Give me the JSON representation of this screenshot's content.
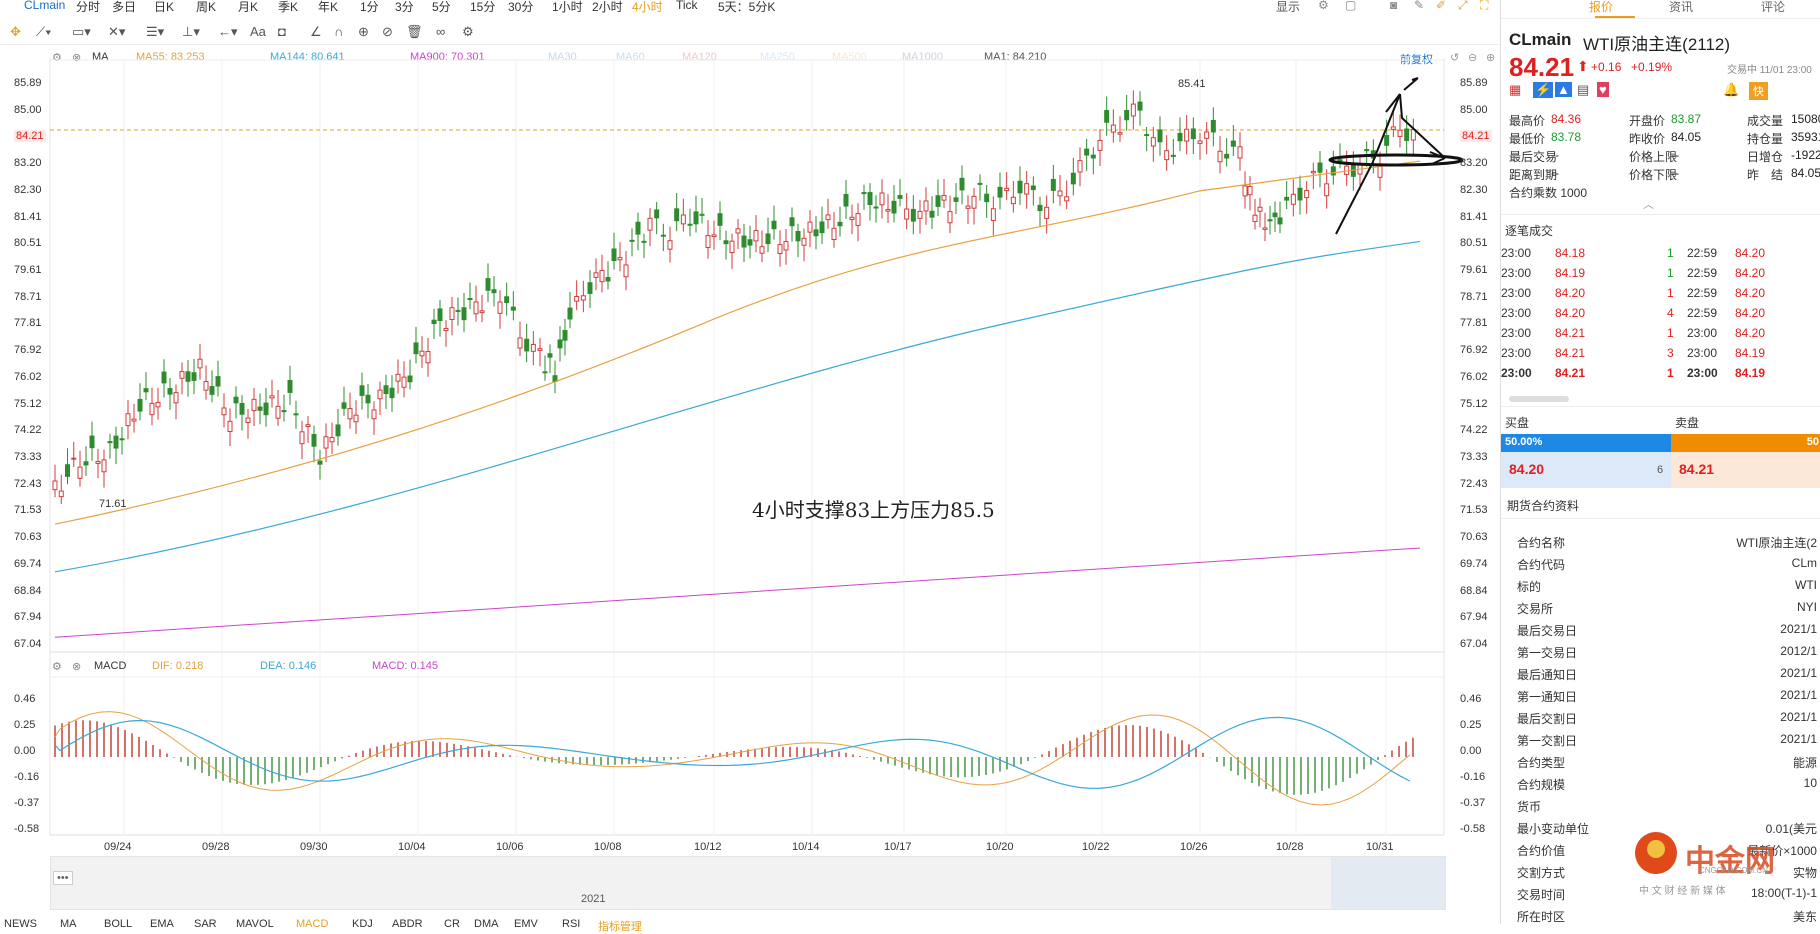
{
  "topbar": {
    "symbol": "CLmain",
    "periods": [
      "分时",
      "多日",
      "日K",
      "周K",
      "月K",
      "季K",
      "年K",
      "1分",
      "3分",
      "5分",
      "15分",
      "30分",
      "1小时",
      "2小时",
      "4小时",
      "Tick",
      "5天：5分K"
    ],
    "active_period": "4小时",
    "display_label": "显示"
  },
  "toolbar": {
    "restore_label": "前复权"
  },
  "ma_legend": {
    "title": "MA",
    "items": [
      {
        "label": "MA55: 83.253",
        "color": "#e8a040"
      },
      {
        "label": "MA144: 80.641",
        "color": "#3aa8d8"
      },
      {
        "label": "MA900: 70.301",
        "color": "#cc44cc"
      },
      {
        "label": "MA30",
        "color": "#c8d8e8"
      },
      {
        "label": "MA60",
        "color": "#c8e0f0"
      },
      {
        "label": "MA120",
        "color": "#f0c8c8"
      },
      {
        "label": "MA250",
        "color": "#d8e8f8"
      },
      {
        "label": "MA500",
        "color": "#f8e8c8"
      },
      {
        "label": "MA1000",
        "color": "#d0d0e0"
      },
      {
        "label": "MA1: 84.210",
        "color": "#555555"
      }
    ]
  },
  "price_axis": [
    "85.89",
    "85.00",
    "84.21",
    "83.20",
    "82.30",
    "81.41",
    "80.51",
    "79.61",
    "78.71",
    "77.81",
    "76.92",
    "76.02",
    "75.12",
    "74.22",
    "73.33",
    "72.43",
    "71.53",
    "70.63",
    "69.74",
    "68.84",
    "67.94",
    "67.04"
  ],
  "annotations": {
    "high_label": "85.41",
    "low_label": "71.61",
    "main_text": "4小时支撑83上方压力85.5"
  },
  "macd_legend": {
    "title": "MACD",
    "dif": "DIF: 0.218",
    "dea": "DEA: 0.146",
    "macd": "MACD: 0.145"
  },
  "macd_axis": [
    "0.46",
    "0.25",
    "0.00",
    "-0.16",
    "-0.37",
    "-0.58"
  ],
  "date_axis": [
    "09/24",
    "09/28",
    "09/30",
    "10/04",
    "10/06",
    "10/08",
    "10/12",
    "10/14",
    "10/17",
    "10/20",
    "10/22",
    "10/26",
    "10/28",
    "10/31"
  ],
  "navigator_year": "2021",
  "bottom_tabs": [
    "NEWS",
    "MA",
    "BOLL",
    "EMA",
    "SAR",
    "MAVOL",
    "MACD",
    "KDJ",
    "ABDR",
    "CR",
    "DMA",
    "EMV",
    "RSI",
    "指标管理"
  ],
  "quote": {
    "tabs": [
      "报价",
      "资讯",
      "评论"
    ],
    "code": "CLmain",
    "name": "WTI原油主连(2112)",
    "price": "84.21",
    "change": "+0.16",
    "change_pct": "+0.19%",
    "trade_time": "交易中 11/01 23:00",
    "fields": [
      {
        "k": "最高价",
        "v": "84.36",
        "c": "red"
      },
      {
        "k": "开盘价",
        "v": "83.87",
        "c": "green"
      },
      {
        "k": "成交量",
        "v": "15080",
        "c": "black"
      },
      {
        "k": "最低价",
        "v": "83.78",
        "c": "green"
      },
      {
        "k": "昨收价",
        "v": "84.05",
        "c": "black"
      },
      {
        "k": "持仓量",
        "v": "35931",
        "c": "black"
      },
      {
        "k": "最后交易",
        "v": "--",
        "c": "black"
      },
      {
        "k": "价格上限",
        "v": "--",
        "c": "black"
      },
      {
        "k": "日增仓",
        "v": "-1922",
        "c": "black"
      },
      {
        "k": "距离到期",
        "v": "--",
        "c": "black"
      },
      {
        "k": "价格下限",
        "v": "--",
        "c": "black"
      },
      {
        "k": "昨　结",
        "v": "84.05",
        "c": "black"
      }
    ],
    "multiplier": "合约乘数 1000"
  },
  "trades": {
    "title": "逐笔成交",
    "rows": [
      {
        "t1": "23:00",
        "p1": "84.18",
        "q": "1",
        "t2": "22:59",
        "p2": "84.20"
      },
      {
        "t1": "23:00",
        "p1": "84.19",
        "q": "1",
        "t2": "22:59",
        "p2": "84.20"
      },
      {
        "t1": "23:00",
        "p1": "84.20",
        "q": "1",
        "t2": "22:59",
        "p2": "84.20"
      },
      {
        "t1": "23:00",
        "p1": "84.20",
        "q": "4",
        "t2": "22:59",
        "p2": "84.20"
      },
      {
        "t1": "23:00",
        "p1": "84.21",
        "q": "1",
        "t2": "23:00",
        "p2": "84.20"
      },
      {
        "t1": "23:00",
        "p1": "84.21",
        "q": "3",
        "t2": "23:00",
        "p2": "84.19"
      },
      {
        "t1": "23:00",
        "p1": "84.21",
        "q": "1",
        "t2": "23:00",
        "p2": "84.19"
      }
    ]
  },
  "book": {
    "buy_label": "买盘",
    "sell_label": "卖盘",
    "buy_pct": "50.00%",
    "sell_pct": "50",
    "bid": "84.20",
    "bid_qty": "6",
    "ask": "84.21"
  },
  "contract": {
    "title": "期货合约资料",
    "rows": [
      {
        "k": "合约名称",
        "v": "WTI原油主连(2"
      },
      {
        "k": "合约代码",
        "v": "CLm"
      },
      {
        "k": "标的",
        "v": "WTI"
      },
      {
        "k": "交易所",
        "v": "NYI"
      },
      {
        "k": "最后交易日",
        "v": "2021/1"
      },
      {
        "k": "第一交易日",
        "v": "2012/1"
      },
      {
        "k": "最后通知日",
        "v": "2021/1"
      },
      {
        "k": "第一通知日",
        "v": "2021/1"
      },
      {
        "k": "最后交割日",
        "v": "2021/1"
      },
      {
        "k": "第一交割日",
        "v": "2021/1"
      },
      {
        "k": "合约类型",
        "v": "能源"
      },
      {
        "k": "合约规模",
        "v": "10"
      },
      {
        "k": "货币",
        "v": ""
      },
      {
        "k": "最小变动单位",
        "v": "0.01(美元"
      },
      {
        "k": "合约价值",
        "v": "最新价×1000"
      },
      {
        "k": "交割方式",
        "v": "实物"
      },
      {
        "k": "交易时间",
        "v": "18:00(T-1)-1"
      },
      {
        "k": "所在时区",
        "v": "美东"
      }
    ]
  },
  "watermark": {
    "brand": "中金网",
    "domain": "CNGOLD.COM.CN",
    "slogan": "中 文 财 经 新 媒 体"
  }
}
